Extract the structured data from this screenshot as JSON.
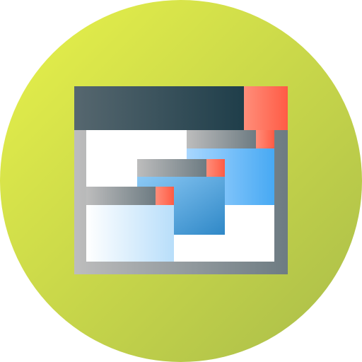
{
  "icon": {
    "name": "stacked-windows-icon",
    "palette": {
      "circle_start": "#E8F24A",
      "circle_end": "#A9BC4A",
      "titlebar_start": "#56676F",
      "titlebar_end": "#1F3E4A",
      "close_start": "#FF8E7A",
      "close_end": "#FF5B45",
      "frame_start": "#BDBDBD",
      "frame_end": "#6D7B82",
      "content": "#FFFFFF",
      "blue_start": "#A9D7FF",
      "blue_end": "#47A9F3",
      "mid_blue_start": "#8CC9F5",
      "mid_blue_end": "#2F88C7",
      "pale_start": "#FFFFFF",
      "pale_end": "#B8DEFA"
    }
  }
}
